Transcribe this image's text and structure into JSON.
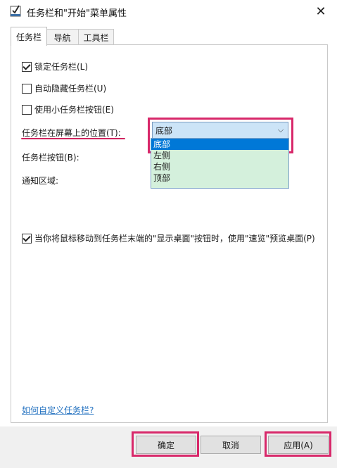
{
  "window": {
    "title": "任务栏和\"开始\"菜单属性",
    "close_glyph": "✕"
  },
  "tabs": [
    {
      "label": "任务栏",
      "active": true
    },
    {
      "label": "导航",
      "active": false
    },
    {
      "label": "工具栏",
      "active": false
    }
  ],
  "options": {
    "lock_taskbar": {
      "label": "锁定任务栏(L)",
      "checked": true
    },
    "auto_hide": {
      "label": "自动隐藏任务栏(U)",
      "checked": false
    },
    "small_buttons": {
      "label": "使用小任务栏按钮(E)",
      "checked": false
    },
    "peek": {
      "label": "当你将鼠标移动到任务栏末端的\"显示桌面\"按钮时，使用\"速览\"预览桌面(P)",
      "checked": true
    }
  },
  "position": {
    "label": "任务栏在屏幕上的位置(T):",
    "selected": "底部",
    "arrow_glyph": "⌵",
    "list": [
      "底部",
      "左侧",
      "右侧",
      "顶部"
    ]
  },
  "buttons_label": "任务栏按钮(B):",
  "notify_label": "通知区域:",
  "help_link": "如何自定义任务栏?",
  "footer": {
    "ok": "确定",
    "cancel": "取消",
    "apply": "应用(A)"
  },
  "colors": {
    "highlight": "#d8286a",
    "selected_option": "#0078d7",
    "listbox_bg": "#d4f0dc",
    "dropdown_bg": "#cce4f7",
    "link": "#1f6fbf"
  }
}
